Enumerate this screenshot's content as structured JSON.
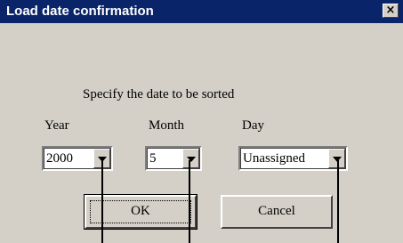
{
  "window": {
    "title": "Load date confirmation",
    "close_label": "×"
  },
  "dialog": {
    "instruction": "Specify the date to be sorted",
    "year": {
      "label": "Year",
      "value": "2000"
    },
    "month": {
      "label": "Month",
      "value": "5"
    },
    "day": {
      "label": "Day",
      "value": "Unassigned"
    },
    "ok_label": "OK",
    "cancel_label": "Cancel"
  },
  "colors": {
    "titlebar": "#0a246a",
    "face": "#d4d0c8",
    "field": "#ffffff"
  },
  "icons": {
    "close": "close-icon",
    "dropdown": "chevron-down-icon"
  }
}
